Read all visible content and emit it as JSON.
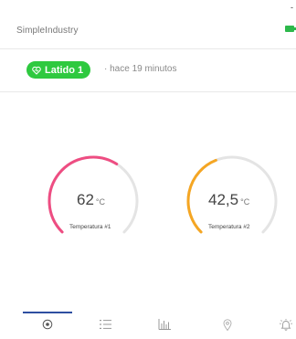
{
  "status": {
    "indicator": "-"
  },
  "header": {
    "title": "SimpleIndustry",
    "battery_icon": "battery-icon",
    "battery_color": "#2db84b"
  },
  "heartbeat": {
    "label": "Latido 1",
    "icon": "heart-pulse-icon",
    "color": "#2ec93f",
    "last_seen": "· hace 19 minutos"
  },
  "gauges": [
    {
      "value": "62",
      "unit": "°C",
      "label": "Temperatura #1",
      "color": "#ee4d82",
      "fill_fraction": 0.62
    },
    {
      "value": "42,5",
      "unit": "°C",
      "label": "Temperatura #2",
      "color": "#f5a623",
      "fill_fraction": 0.42
    }
  ],
  "tabs": [
    {
      "name": "tab-dashboard",
      "icon": "target-icon",
      "active": true
    },
    {
      "name": "tab-list",
      "icon": "list-icon",
      "active": false
    },
    {
      "name": "tab-charts",
      "icon": "bar-chart-icon",
      "active": false
    },
    {
      "name": "tab-location",
      "icon": "map-pin-icon",
      "active": false
    },
    {
      "name": "tab-alarms",
      "icon": "alarm-bell-icon",
      "active": false
    }
  ],
  "accent_color": "#2e4fa1"
}
